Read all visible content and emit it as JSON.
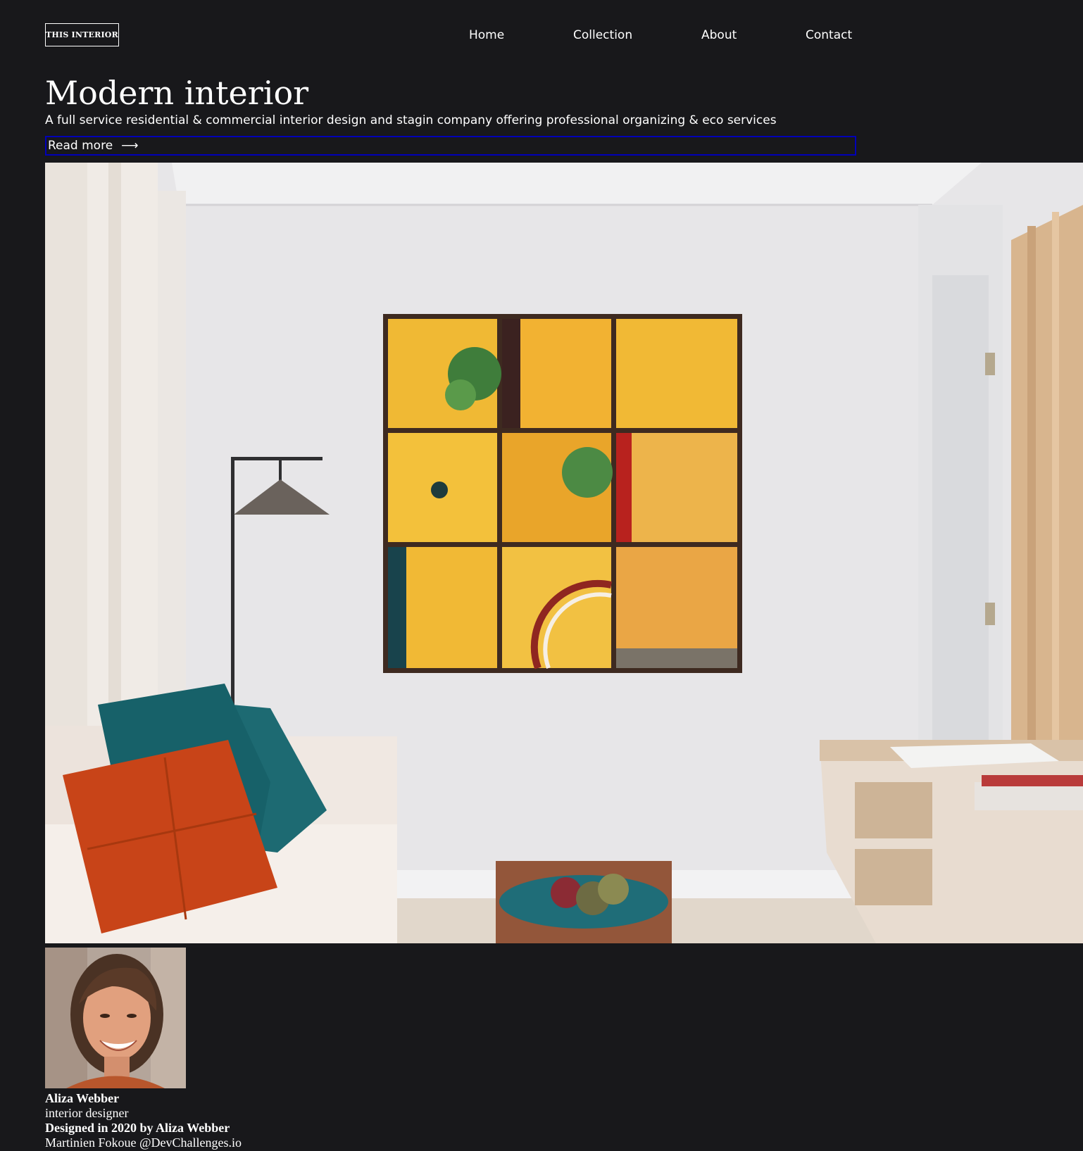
{
  "header": {
    "logo_text": "THIS INTERIOR",
    "nav": [
      {
        "label": "Home"
      },
      {
        "label": "Collection"
      },
      {
        "label": "About"
      },
      {
        "label": "Contact"
      }
    ]
  },
  "hero": {
    "title": "Modern interior",
    "subtitle": "A full service residential & commercial interior design and stagin company offering professional organizing & eco services",
    "read_more_label": "Read more",
    "read_more_arrow": "⟶",
    "image_icon": "living-room-photo"
  },
  "designer": {
    "avatar_icon": "designer-portrait-photo",
    "name": "Aliza Webber",
    "role": "interior designer"
  },
  "footer": {
    "credit": "Designed in 2020 by Aliza Webber",
    "author": "Martinien Fokoue @DevChallenges.io"
  },
  "colors": {
    "background": "#18181b",
    "text": "#ffffff",
    "focus_outline": "#0000b8"
  }
}
